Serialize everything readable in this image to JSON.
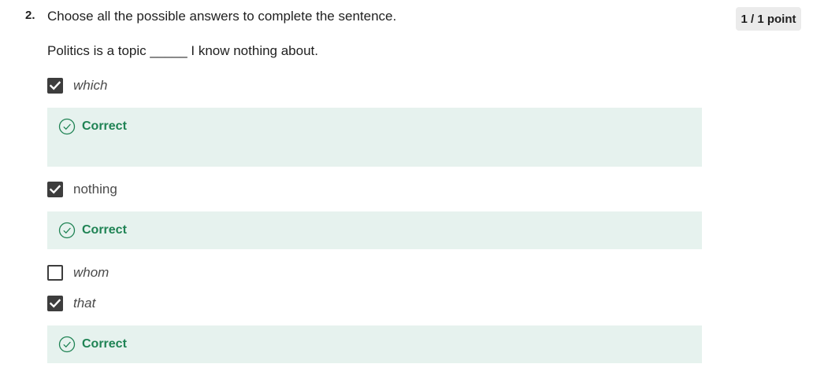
{
  "question": {
    "number": "2.",
    "prompt": "Choose all the possible answers to complete the sentence.",
    "points": "1 / 1 point",
    "sentence": "Politics is a topic _____ I know nothing about."
  },
  "options": [
    {
      "label": "which",
      "checked": true,
      "feedback": "Correct"
    },
    {
      "label": "nothing",
      "checked": true,
      "feedback": "Correct"
    },
    {
      "label": "whom",
      "checked": false
    },
    {
      "label": "that",
      "checked": true,
      "feedback": "Correct"
    }
  ],
  "colors": {
    "correct_text": "#1f8354",
    "correct_bg": "#e6f2ee",
    "checkbox": "#3d3d3d"
  },
  "icons": {
    "checked": "checkmark-icon",
    "feedback": "check-circle-icon"
  }
}
